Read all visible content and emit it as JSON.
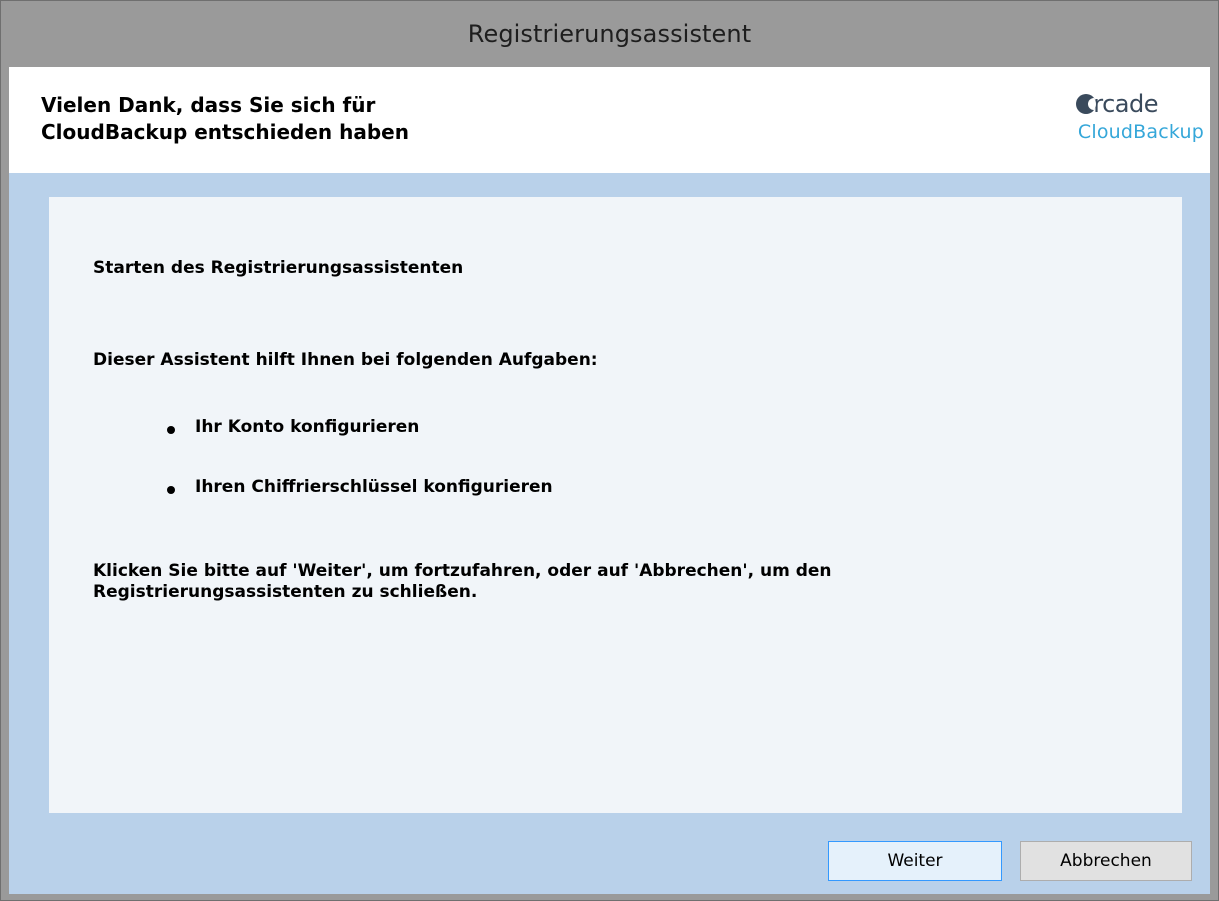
{
  "window": {
    "title": "Registrierungsassistent"
  },
  "header": {
    "title_line1": "Vielen Dank, dass Sie sich für",
    "title_line2": "CloudBackup entschieden haben",
    "logo": {
      "word": "arcade",
      "word_visible": "rcade",
      "sub": "CloudBackup",
      "accent_color": "#35a7d9",
      "dark_color": "#3a4a5c"
    }
  },
  "content": {
    "heading": "Starten des Registrierungsassistenten",
    "intro": "Dieser Assistent hilft Ihnen bei folgenden Aufgaben:",
    "bullets": [
      "Ihr Konto konfigurieren",
      "Ihren Chiffrierschlüssel konfigurieren"
    ],
    "closing_line1": "Klicken Sie bitte auf 'Weiter', um fortzufahren, oder auf 'Abbrechen', um den",
    "closing_line2": "Registrierungsassistenten zu schließen."
  },
  "buttons": {
    "next_label": "Weiter",
    "cancel_label": "Abbrechen"
  },
  "colors": {
    "client_background": "#b9d1ea",
    "panel_background": "#f1f5f9",
    "frame": "#9a9a9a",
    "focus_border": "#3399ff"
  }
}
